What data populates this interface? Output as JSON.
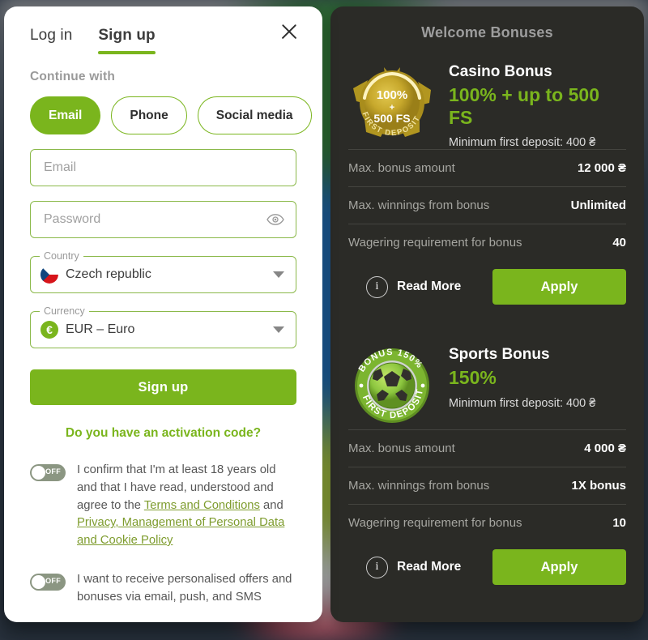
{
  "auth": {
    "tabs": [
      {
        "label": "Log in",
        "active": false
      },
      {
        "label": "Sign up",
        "active": true
      }
    ],
    "close_icon": "close-icon",
    "continue_with": "Continue with",
    "methods": [
      {
        "label": "Email",
        "selected": true
      },
      {
        "label": "Phone",
        "selected": false
      },
      {
        "label": "Social media",
        "selected": false
      }
    ],
    "email": {
      "placeholder": "Email",
      "value": ""
    },
    "password": {
      "placeholder": "Password",
      "value": "",
      "reveal_icon": "eye-icon"
    },
    "country": {
      "legend": "Country",
      "value": "Czech republic",
      "flag_icon": "czech-flag-icon",
      "caret_icon": "chevron-down-icon"
    },
    "currency": {
      "legend": "Currency",
      "value": "EUR – Euro",
      "symbol": "€",
      "caret_icon": "chevron-down-icon"
    },
    "signup_button": "Sign up",
    "activation_link": "Do you have an activation code?",
    "consents": [
      {
        "toggle_state": "OFF",
        "parts": [
          {
            "text": "I confirm that I'm at least 18 years old and that I have read, understood and agree to the ",
            "link": false
          },
          {
            "text": "Terms and Conditions",
            "link": true
          },
          {
            "text": " and ",
            "link": false
          },
          {
            "text": "Privacy, Management of Personal Data and Cookie Policy",
            "link": true
          }
        ]
      },
      {
        "toggle_state": "OFF",
        "parts": [
          {
            "text": "I want to receive personalised offers and bonuses via email, push, and SMS",
            "link": false
          }
        ]
      }
    ]
  },
  "bonuses": {
    "title": "Welcome Bonuses",
    "items": [
      {
        "badge": {
          "icon": "casino-gold-medal-icon",
          "line1": "100%",
          "line2": "+",
          "line3": "500 FS",
          "arc": "FIRST DEPOSIT",
          "style": "gold"
        },
        "name": "Casino Bonus",
        "value": "100% + up to 500 FS",
        "min_deposit": "Minimum first deposit: 400 ₴",
        "stats": [
          {
            "key": "Max. bonus amount",
            "value": "12 000 ₴"
          },
          {
            "key": "Max. winnings from bonus",
            "value": "Unlimited"
          },
          {
            "key": "Wagering requirement for bonus",
            "value": "40"
          }
        ],
        "read_more": "Read More",
        "info_icon": "info-icon",
        "apply": "Apply"
      },
      {
        "badge": {
          "icon": "sports-football-badge-icon",
          "arc_top": "BONUS 150%",
          "arc": "FIRST DEPOSIT",
          "style": "green"
        },
        "name": "Sports Bonus",
        "value": "150%",
        "min_deposit": "Minimum first deposit: 400 ₴",
        "stats": [
          {
            "key": "Max. bonus amount",
            "value": "4 000 ₴"
          },
          {
            "key": "Max. winnings from bonus",
            "value": "1X bonus"
          },
          {
            "key": "Wagering requirement for bonus",
            "value": "10"
          }
        ],
        "read_more": "Read More",
        "info_icon": "info-icon",
        "apply": "Apply"
      }
    ]
  },
  "colors": {
    "accent_green": "#7ab51d",
    "panel_dark": "#2b2b27",
    "gold": "#c9a227"
  }
}
